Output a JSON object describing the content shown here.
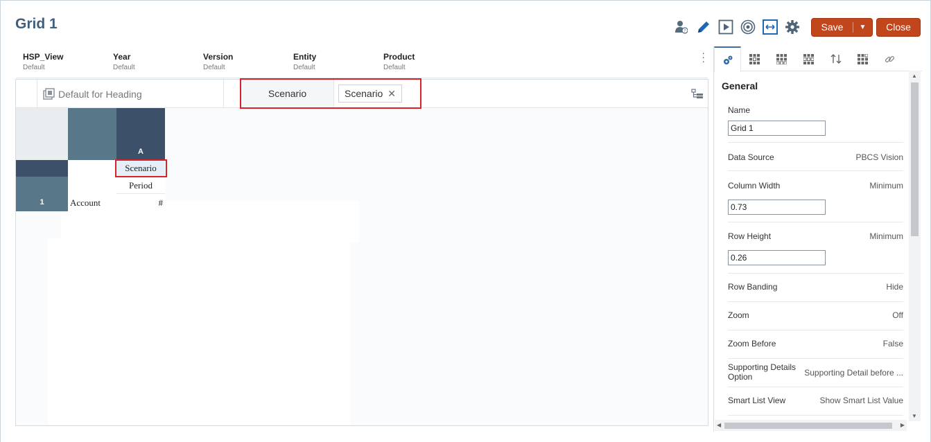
{
  "header": {
    "title": "Grid 1",
    "save_label": "Save",
    "close_label": "Close"
  },
  "pov": [
    {
      "name": "HSP_View",
      "value": "Default"
    },
    {
      "name": "Year",
      "value": "Default"
    },
    {
      "name": "Version",
      "value": "Default"
    },
    {
      "name": "Entity",
      "value": "Default"
    },
    {
      "name": "Product",
      "value": "Default"
    }
  ],
  "header_bar": {
    "default_heading": "Default for Heading",
    "scenario_label": "Scenario",
    "scenario_chip": "Scenario",
    "chip_remove": "✕"
  },
  "grid": {
    "col_header": "A",
    "col_dims": [
      "Scenario",
      "Period"
    ],
    "row_header": "1",
    "row_dim": "Account",
    "data_symbol": "#"
  },
  "panel": {
    "section_title": "General",
    "rows": {
      "name": {
        "label": "Name",
        "input": "Grid 1"
      },
      "data_source": {
        "label": "Data Source",
        "value": "PBCS Vision"
      },
      "column_width": {
        "label": "Column Width",
        "value": "Minimum",
        "input": "0.73"
      },
      "row_height": {
        "label": "Row Height",
        "value": "Minimum",
        "input": "0.26"
      },
      "row_banding": {
        "label": "Row Banding",
        "value": "Hide"
      },
      "zoom": {
        "label": "Zoom",
        "value": "Off"
      },
      "zoom_before": {
        "label": "Zoom Before",
        "value": "False"
      },
      "supporting_details": {
        "label_line1": "Supporting Details",
        "label_line2": "Option",
        "value": "Supporting Detail before ..."
      },
      "smart_list_view": {
        "label": "Smart List View",
        "value": "Show Smart List Value"
      }
    }
  },
  "icons": {
    "toolbar": [
      "user-question-icon",
      "pencil-icon",
      "play-icon",
      "target-icon",
      "fit-width-icon",
      "gear-icon"
    ],
    "panel_tabs": [
      "gears-icon",
      "grid-icon",
      "grid-icon",
      "grid-icon",
      "sort-icon",
      "grid-icon",
      "link-icon"
    ]
  },
  "colors": {
    "title": "#3f5f7d",
    "button": "#c1461b",
    "highlight": "#d7222a",
    "header_dark": "#3d506a",
    "header_mid": "#587789"
  }
}
